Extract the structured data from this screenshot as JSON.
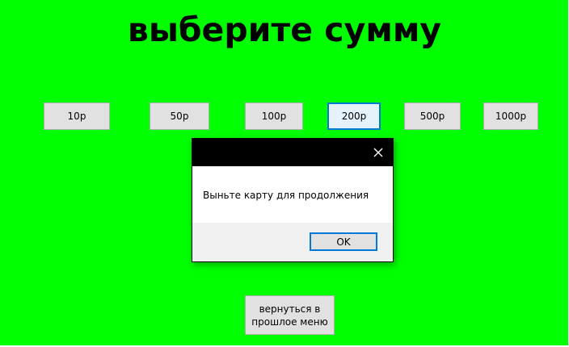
{
  "window": {
    "title": "выберите сумму"
  },
  "amounts": [
    {
      "label": "10р"
    },
    {
      "label": "50р"
    },
    {
      "label": "100р"
    },
    {
      "label": "200р"
    },
    {
      "label": "500р"
    },
    {
      "label": "1000р"
    }
  ],
  "back_button": {
    "label": "вернуться в\nпрошлое меню"
  },
  "dialog": {
    "message": "Выньте карту для продолжения",
    "ok_label": "OK",
    "close_icon": "close-icon"
  },
  "colors": {
    "background": "#00ff00",
    "focus": "#0078d7",
    "dialog_titlebar": "#000000"
  }
}
